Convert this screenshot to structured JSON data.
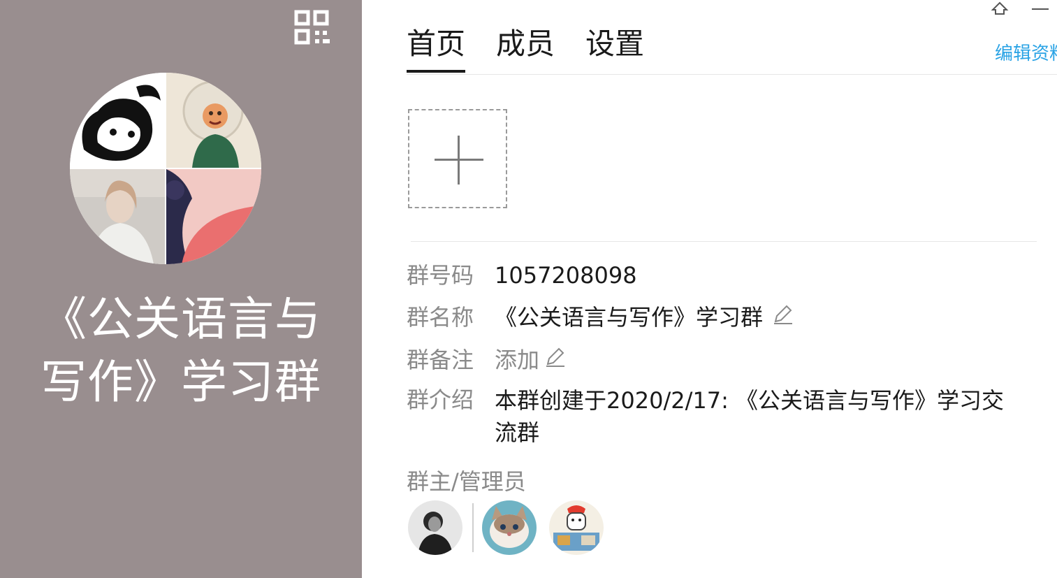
{
  "left_panel": {
    "group_title": "《公关语言与写作》学习群",
    "qr_icon": "qr-code-icon",
    "avatar_icon": "group-avatar-collage"
  },
  "window_controls": {
    "pin_icon": "pin-icon",
    "minimize_icon": "minimize-icon"
  },
  "tabs": [
    {
      "label": "首页",
      "active": true
    },
    {
      "label": "成员",
      "active": false
    },
    {
      "label": "设置",
      "active": false
    }
  ],
  "edit_profile_link": "编辑资料",
  "add_photo_icon": "plus-icon",
  "info": {
    "group_number_label": "群号码",
    "group_number_value": "1057208098",
    "group_name_label": "群名称",
    "group_name_value": "《公关语言与写作》学习群",
    "group_remark_label": "群备注",
    "group_remark_value": "添加",
    "group_intro_label": "群介绍",
    "group_intro_value": "本群创建于2020/2/17: 《公关语言与写作》学习交流群"
  },
  "admins": {
    "label": "群主/管理员",
    "avatars": [
      "owner-avatar",
      "admin-avatar-cat",
      "admin-avatar-cartoon"
    ]
  },
  "colors": {
    "left_panel_bg": "#998e8f",
    "link_blue": "#2aa3e5",
    "label_gray": "#8a8a8a",
    "text_dark": "#1a1a1a"
  }
}
